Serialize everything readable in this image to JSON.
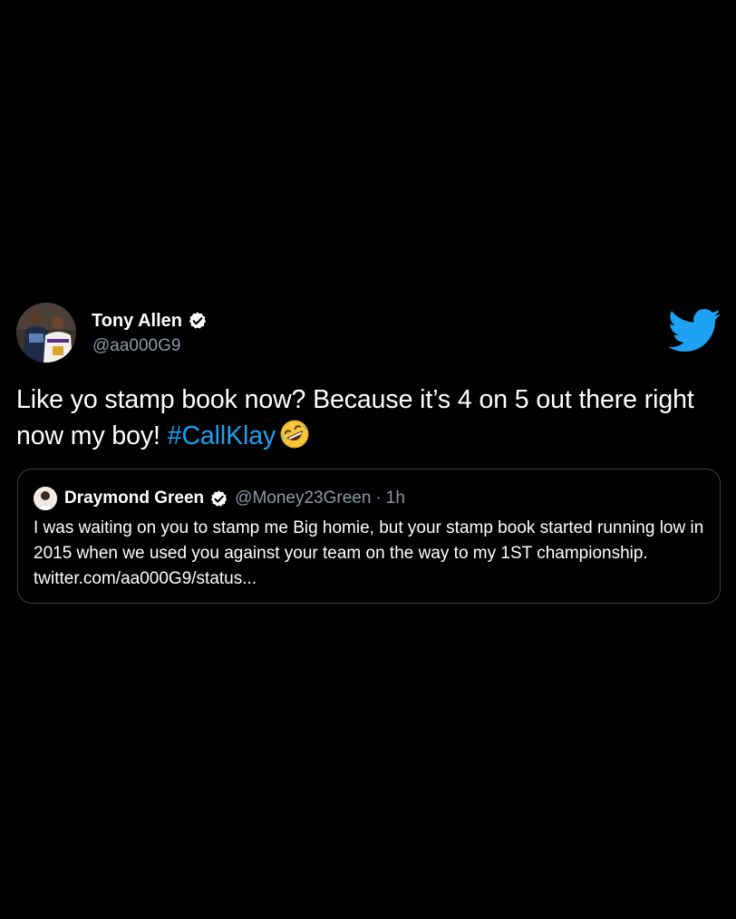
{
  "tweet": {
    "author_name": "Tony Allen",
    "author_handle": "@aa000G9",
    "text_main": "Like yo stamp book now? Because it’s 4 on 5 out there right now my boy! ",
    "hashtag": "#CallKlay",
    "emoji": "rolling-on-floor-laughing-emoji",
    "icons": {
      "verified": "verified-badge-icon",
      "brand": "twitter-bird-icon"
    }
  },
  "quote": {
    "author_name": "Draymond Green",
    "author_handle": "@Money23Green",
    "separator": "·",
    "time": "1h",
    "text": "I was waiting on you to stamp me Big homie, but your stamp book started running low in 2015 when we used you against your team on the way to my 1ST championship. twitter.com/aa000G9/status..."
  },
  "colors": {
    "background": "#000000",
    "text": "#ffffff",
    "secondary_text": "#8b98a5",
    "accent": "#1da1f2",
    "quote_border": "#3d4248"
  }
}
